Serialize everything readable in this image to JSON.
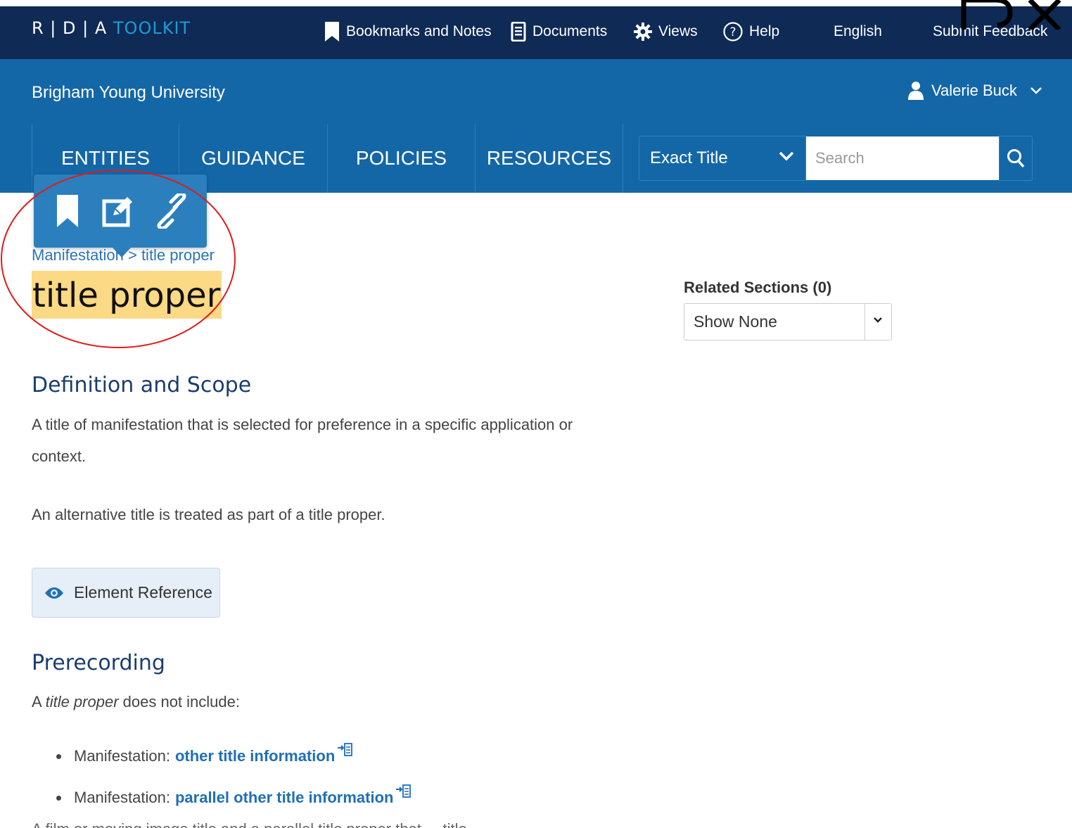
{
  "topbar": {
    "brand_letters": "R | D | A ",
    "brand_toolkit": "TOOLKIT",
    "items": [
      {
        "label": "Bookmarks and Notes",
        "icon": "bookmark-icon"
      },
      {
        "label": "Documents",
        "icon": "document-icon"
      },
      {
        "label": "Views",
        "icon": "gear-icon"
      },
      {
        "label": "Help",
        "icon": "help-icon"
      },
      {
        "label": "English"
      },
      {
        "label": "Submit Feedback"
      }
    ]
  },
  "header": {
    "institution": "Brigham Young University",
    "user_name": "Valerie Buck"
  },
  "mainnav": {
    "items": [
      "ENTITIES",
      "GUIDANCE",
      "POLICIES",
      "RESOURCES"
    ]
  },
  "search": {
    "mode": "Exact Title",
    "placeholder": "Search"
  },
  "popover": {
    "icons": [
      "bookmark-icon",
      "edit-note-icon",
      "link-icon"
    ]
  },
  "breadcrumb": {
    "parent": "Manifestation",
    "separator": " > ",
    "current": "title proper"
  },
  "page": {
    "title": "title proper"
  },
  "related": {
    "label": "Related Sections (0)",
    "selected": "Show None"
  },
  "content": {
    "definition_heading": "Definition and Scope",
    "definition_text": "A title of manifestation that is selected for preference in a specific application or context.",
    "alternative_text": "An alternative title is treated as part of a title proper.",
    "element_reference_label": "Element Reference",
    "prerecording_heading": "Prerecording",
    "prerecording_intro_a": "A ",
    "prerecording_intro_em": "title proper",
    "prerecording_intro_b": " does not include:",
    "bullets": [
      {
        "prefix": "Manifestation:",
        "link": "other title information"
      },
      {
        "prefix": "Manifestation:",
        "link": "parallel other title information"
      }
    ],
    "cut_line": "A film or moving image title and a parallel title proper that ... title"
  },
  "colors": {
    "topbar_bg": "#0e2a55",
    "header_bg": "#1467a7",
    "highlight": "#fcd985",
    "annotation_ellipse": "#e01b1b",
    "link": "#1f6fb6"
  }
}
